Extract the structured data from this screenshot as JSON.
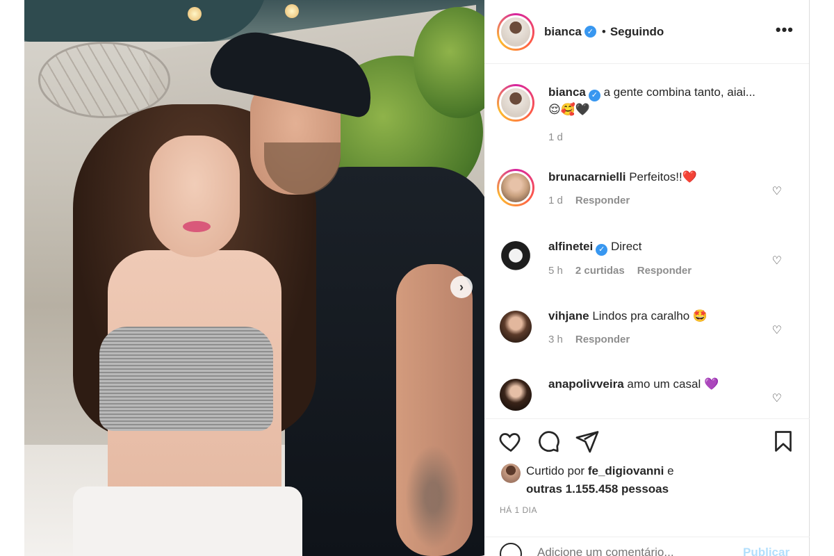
{
  "post": {
    "image_alt": "Casal posando em varanda",
    "carousel_next_icon": "chevron-right-icon"
  },
  "header": {
    "username": "bianca",
    "separator": "•",
    "following_label": "Seguindo",
    "more_icon": "more-horizontal-icon",
    "more_label": "•••"
  },
  "caption": {
    "username": "bianca",
    "text": "a gente combina tanto, aiai...",
    "emojis": "😌🥰🖤",
    "age": "1 d"
  },
  "comments": [
    {
      "username": "brunacarnielli",
      "verified": false,
      "text": "Perfeitos!!❤️",
      "age": "1 d",
      "likes": "",
      "reply_label": "Responder"
    },
    {
      "username": "alfinetei",
      "verified": true,
      "text": "Direct",
      "age": "5 h",
      "likes": "2 curtidas",
      "reply_label": "Responder"
    },
    {
      "username": "vihjane",
      "verified": false,
      "text": "Lindos pra caralho 🤩",
      "age": "3 h",
      "likes": "",
      "reply_label": "Responder"
    },
    {
      "username": "anapolivveira",
      "verified": false,
      "text": "amo um casal 💜",
      "age": "",
      "likes": "",
      "reply_label": ""
    }
  ],
  "actions": {
    "like_icon": "heart-icon",
    "comment_icon": "comment-icon",
    "share_icon": "send-icon",
    "save_icon": "bookmark-icon"
  },
  "likes": {
    "prefix": "Curtido por ",
    "user": "fe_digiovanni",
    "suffix": " e",
    "others": "outras 1.155.458 pessoas"
  },
  "timestamp": "HÁ 1 DIA",
  "add_comment": {
    "placeholder": "Adicione um comentário...",
    "publish_label": "Publicar"
  },
  "colors": {
    "verified": "#3897f0",
    "muted": "#8e8e8e",
    "publish_disabled": "#b2dffc"
  }
}
